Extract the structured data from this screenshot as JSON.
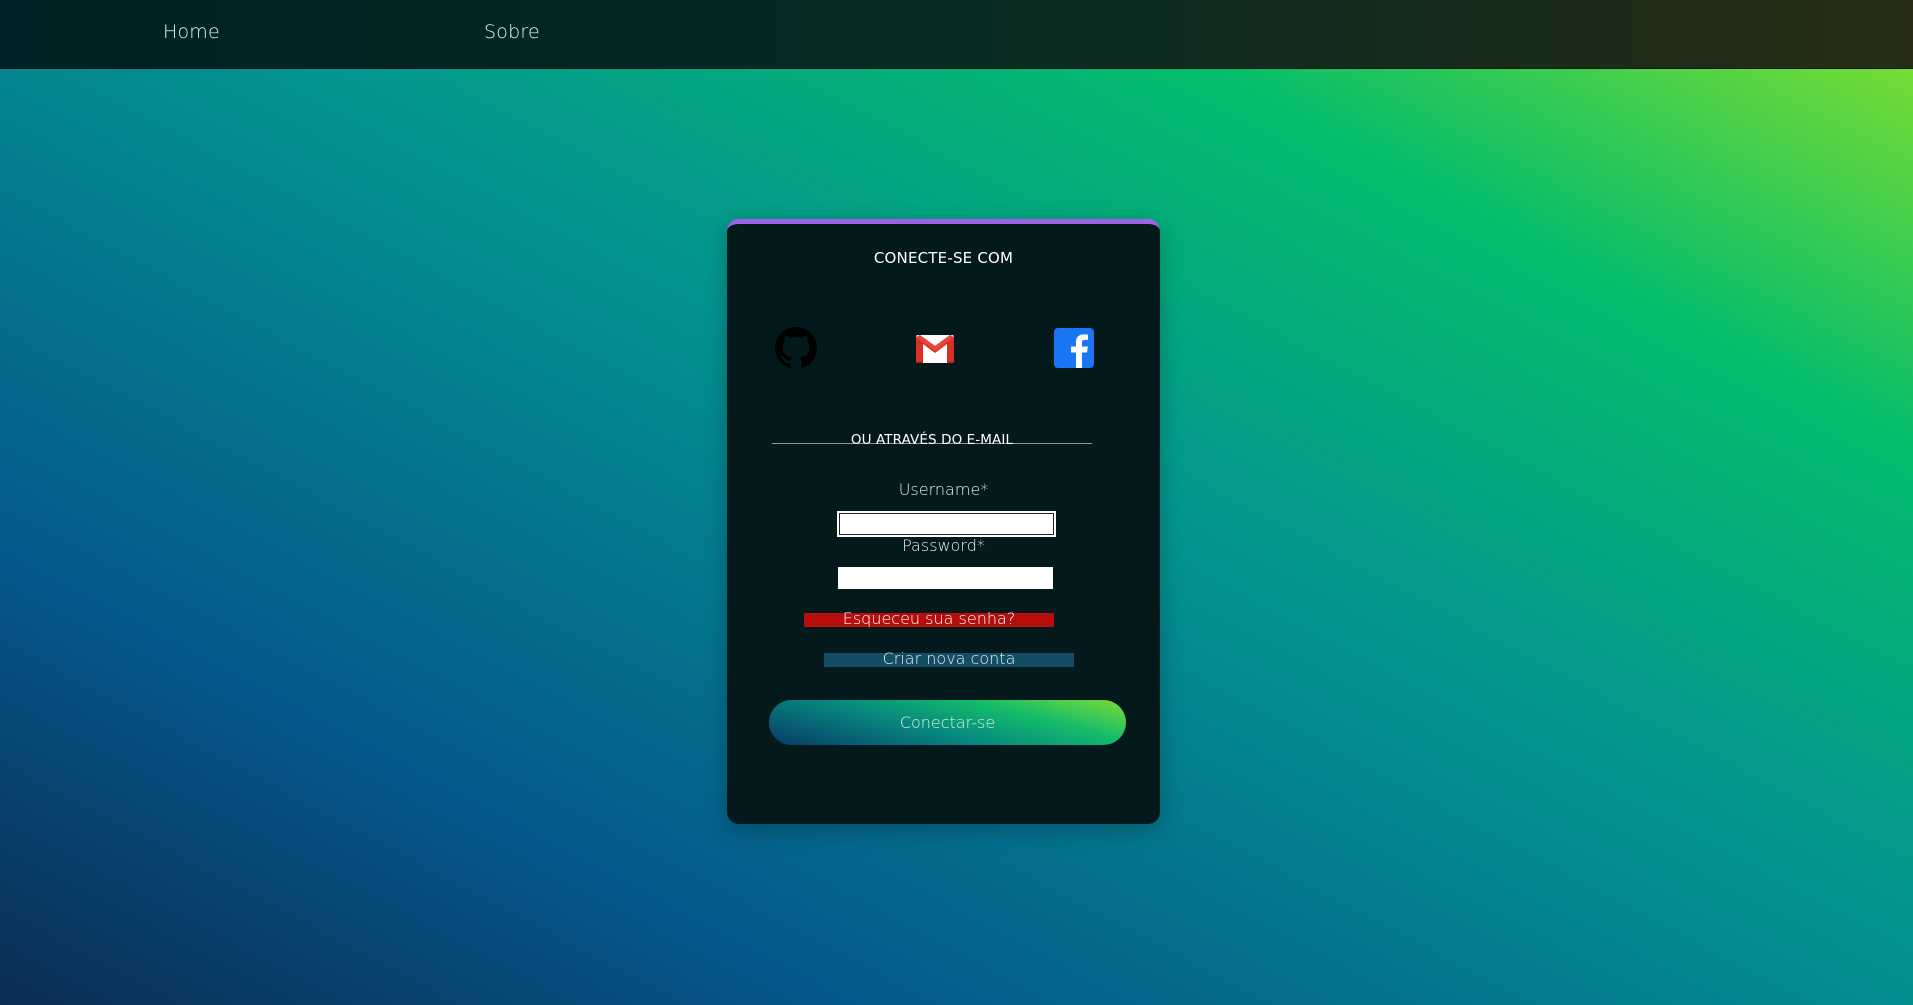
{
  "nav": {
    "home_label": "Home",
    "sobre_label": "Sobre"
  },
  "login": {
    "title": "CONECTE-SE COM",
    "social": [
      {
        "name": "github-icon"
      },
      {
        "name": "gmail-icon"
      },
      {
        "name": "facebook-icon"
      }
    ],
    "divider_text": "OU ATRAVÉS DO E-MAIL",
    "username_label": "Username*",
    "username_value": "",
    "password_label": "Password*",
    "password_value": "",
    "forgot_label": "Esqueceu sua senha?",
    "create_label": "Criar nova conta",
    "connect_label": "Conectar-se"
  },
  "colors": {
    "card_top_border": "#9d63e6",
    "forgot_bg": "#b60d0d",
    "create_bg": "#144d64",
    "facebook_blue": "#1977f3",
    "gmail_red": "#d93025"
  }
}
